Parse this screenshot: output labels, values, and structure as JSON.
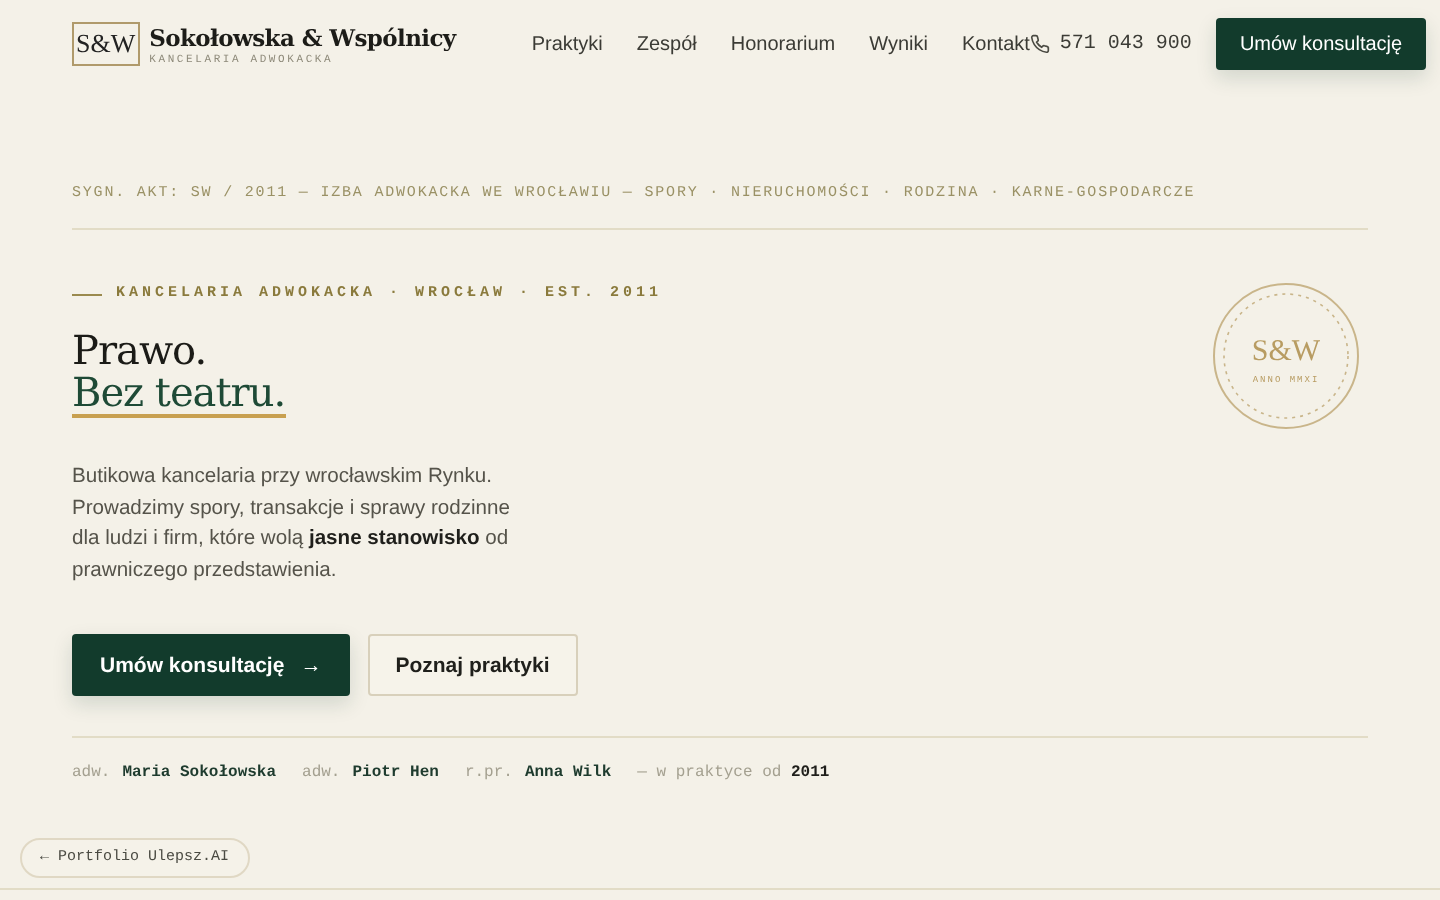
{
  "brand": {
    "logo": "S&W",
    "name": "Sokołowska & Wspólnicy",
    "tagline": "KANCELARIA ADWOKACKA"
  },
  "nav": [
    {
      "label": "Praktyki"
    },
    {
      "label": "Zespół"
    },
    {
      "label": "Honorarium"
    },
    {
      "label": "Wyniki"
    },
    {
      "label": "Kontakt"
    }
  ],
  "phone": "571 043 900",
  "header_button": "Umów konsultację",
  "meta_line": "SYGN. AKT: SW / 2011  —  IZBA ADWOKACKA WE WROCŁAWIU  —  SPORY · NIERUCHOMOŚCI · RODZINA · KARNE-GOSPODARCZE",
  "hero": {
    "eyebrow": "KANCELARIA ADWOKACKA · WROCŁAW · EST. 2011",
    "title_line_1": "Prawo.",
    "title_line_2": "Bez teatru.",
    "lead": "Butikowa kancelaria przy wrocławskim Rynku. Prowadzimy spory, transakcje i sprawy rodzinne dla ludzi i firm, które wolą **jasne stanowisko** od prawniczego przedstawienia.",
    "primary_button": "Umów konsultację",
    "primary_arrow": "→",
    "secondary_button": "Poznaj praktyki"
  },
  "seal": {
    "monogram": "S&W",
    "caption": "ANNO MMXI"
  },
  "team": [
    {
      "role": "adw.",
      "name": "Maria Sokołowska"
    },
    {
      "role": "adw.",
      "name": "Piotr Hen"
    },
    {
      "role": "r.pr.",
      "name": "Anna Wilk"
    }
  ],
  "since": "— w praktyce od **2011**",
  "portfolio_link": "← Portfolio Ulepsz.AI"
}
